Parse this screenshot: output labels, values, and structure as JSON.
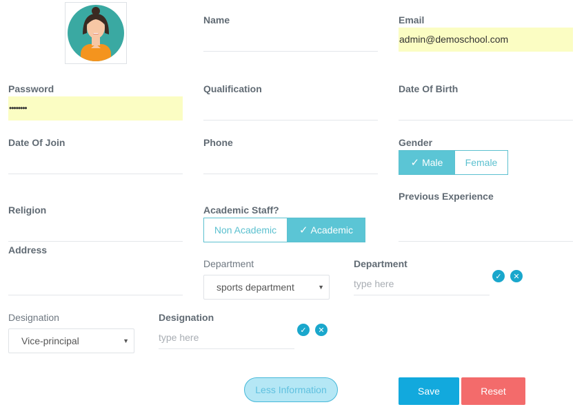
{
  "avatar": {
    "icon": "user-avatar-icon"
  },
  "fields": {
    "name": {
      "label": "Name",
      "value": ""
    },
    "email": {
      "label": "Email",
      "value": "admin@demoschool.com"
    },
    "password": {
      "label": "Password",
      "value": "••••••••"
    },
    "qualification": {
      "label": "Qualification",
      "value": ""
    },
    "dob": {
      "label": "Date Of Birth",
      "value": ""
    },
    "doj": {
      "label": "Date Of Join",
      "value": ""
    },
    "phone": {
      "label": "Phone",
      "value": ""
    },
    "religion": {
      "label": "Religion",
      "value": ""
    },
    "previous_experience": {
      "label": "Previous Experience",
      "value": ""
    },
    "address": {
      "label": "Address",
      "value": ""
    }
  },
  "gender": {
    "label": "Gender",
    "options": [
      "Male",
      "Female"
    ],
    "selected": "Male"
  },
  "academic": {
    "label": "Academic Staff?",
    "options": [
      "Non Academic",
      "Academic"
    ],
    "selected": "Academic"
  },
  "department": {
    "select_label": "Department",
    "selected": "sports department",
    "new_label": "Department",
    "placeholder": "type here"
  },
  "designation": {
    "select_label": "Designation",
    "selected": "Vice-principal",
    "new_label": "Designation",
    "placeholder": "type here"
  },
  "buttons": {
    "less_info": "Less Information",
    "save": "Save",
    "reset": "Reset"
  },
  "colors": {
    "accent": "#5bc5d5",
    "save": "#12a9dd",
    "reset": "#f36b6b",
    "autofill": "#fbfdc3"
  }
}
